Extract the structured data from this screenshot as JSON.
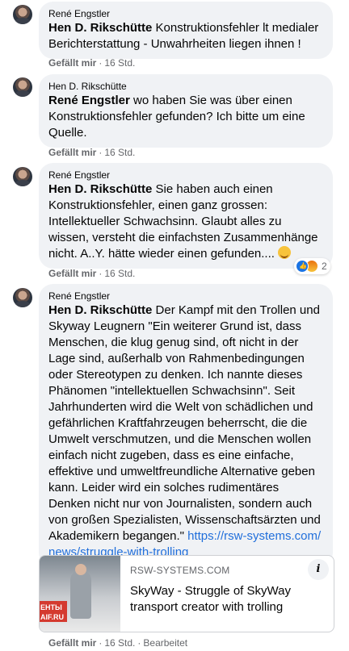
{
  "comments": [
    {
      "author": "René Engstler",
      "mention": "Hen D. Rikschütte",
      "text": " Konstruktionsfehler lt medialer Berichterstattung - Unwahrheiten liegen ihnen !",
      "like_label": "Gefällt mir",
      "time": "16 Std."
    },
    {
      "author": "Hen D. Rikschütte",
      "mention": "René Engstler",
      "text": " wo haben Sie was über einen Konstruktionsfehler gefunden? Ich bitte um eine Quelle.",
      "like_label": "Gefällt mir",
      "time": "16 Std."
    },
    {
      "author": "René Engstler",
      "mention": "Hen D. Rikschütte",
      "text": " Sie haben auch einen Konstruktionsfehler, einen ganz grossen: Intellektueller Schwachsinn. Glaubt alles zu wissen, versteht die einfachsten Zusammenhänge nicht. A..Y. hätte wieder einen gefunden....",
      "like_label": "Gefällt mir",
      "time": "16 Std.",
      "reaction_count": "2"
    },
    {
      "author": "René Engstler",
      "mention": "Hen D. Rikschütte",
      "text": " Der Kampf mit den Trollen und Skyway Leugnern \"Ein weiterer Grund ist, dass Menschen, die klug genug sind, oft nicht in der Lage sind, außerhalb von Rahmenbedingungen oder Stereotypen zu denken. Ich nannte dieses Phänomen \"intellektuellen Schwachsinn\". Seit Jahrhunderten wird die Welt von schädlichen und gefährlichen Kraftfahrzeugen beherrscht, die die Umwelt verschmutzen, und die Menschen wollen einfach nicht zugeben, dass es eine einfache, effektive und umweltfreundliche Alternative geben kann. Leider wird ein solches rudimentäres Denken nicht nur von Journalisten, sondern auch von großen Spezialisten, Wissenschaftsärzten und Akademikern begangen.\" ",
      "link": "https://rsw-systems.com/news/struggle-with-trolling",
      "like_label": "Gefällt mir",
      "time": "16 Std.",
      "edited": "Bearbeitet"
    }
  ],
  "preview": {
    "domain": "RSW-SYSTEMS.COM",
    "title": "SkyWay - Struggle of SkyWay transport creator with trolling",
    "image_banner": "ЕНТЫ AIF.RU",
    "info_icon": "i"
  },
  "colors": {
    "bubble": "#f0f2f5",
    "link": "#216fdb",
    "meta": "#65676b"
  }
}
